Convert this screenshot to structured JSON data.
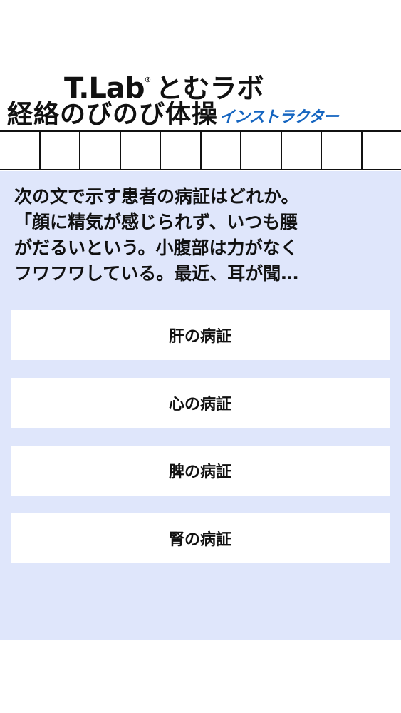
{
  "header": {
    "brand_name": "T.Lab",
    "brand_reg": "®",
    "brand_kana": "とむラボ",
    "title": "経絡のびのび体操",
    "subtitle": "インストラクター"
  },
  "question": {
    "lines": [
      "次の文で示す患者の病証はどれか。",
      "「顔に精気が感じられず、いつも腰",
      "がだるいという。小腹部は力がなく",
      "フワフワしている。最近、耳が聞…"
    ]
  },
  "answers": [
    {
      "label": "肝の病証"
    },
    {
      "label": "心の病証"
    },
    {
      "label": "脾の病証"
    },
    {
      "label": "腎の病証"
    }
  ],
  "colors": {
    "panel_bg": "#dfe6fb",
    "accent": "#1565c0"
  }
}
